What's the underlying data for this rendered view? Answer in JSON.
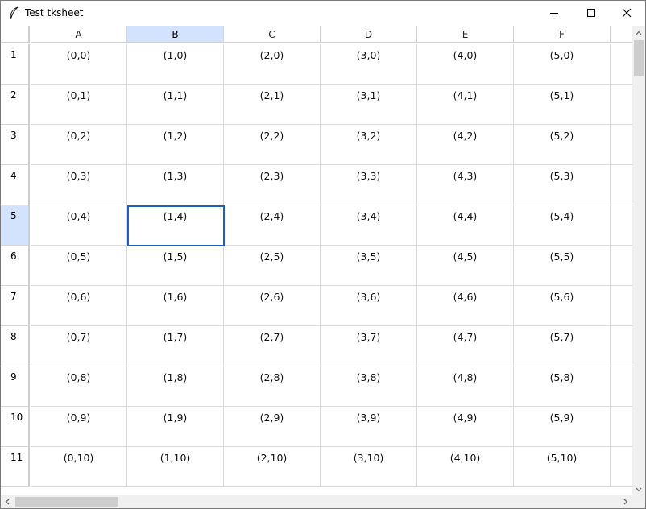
{
  "window": {
    "title": "Test tksheet"
  },
  "icons": {
    "app": "feather-icon",
    "minimize": "minimize-icon",
    "maximize": "maximize-icon",
    "close": "close-icon"
  },
  "colors": {
    "selected_header": "#d3e3fd",
    "selection_border": "#1f5fbf"
  },
  "sheet": {
    "columns": [
      "A",
      "B",
      "C",
      "D",
      "E",
      "F"
    ],
    "selected_column": "B",
    "selected_row": "5",
    "rows": [
      {
        "label": "1",
        "cells": [
          "(0,0)",
          "(1,0)",
          "(2,0)",
          "(3,0)",
          "(4,0)",
          "(5,0)"
        ]
      },
      {
        "label": "2",
        "cells": [
          "(0,1)",
          "(1,1)",
          "(2,1)",
          "(3,1)",
          "(4,1)",
          "(5,1)"
        ]
      },
      {
        "label": "3",
        "cells": [
          "(0,2)",
          "(1,2)",
          "(2,2)",
          "(3,2)",
          "(4,2)",
          "(5,2)"
        ]
      },
      {
        "label": "4",
        "cells": [
          "(0,3)",
          "(1,3)",
          "(2,3)",
          "(3,3)",
          "(4,3)",
          "(5,3)"
        ]
      },
      {
        "label": "5",
        "cells": [
          "(0,4)",
          "(1,4)",
          "(2,4)",
          "(3,4)",
          "(4,4)",
          "(5,4)"
        ]
      },
      {
        "label": "6",
        "cells": [
          "(0,5)",
          "(1,5)",
          "(2,5)",
          "(3,5)",
          "(4,5)",
          "(5,5)"
        ]
      },
      {
        "label": "7",
        "cells": [
          "(0,6)",
          "(1,6)",
          "(2,6)",
          "(3,6)",
          "(4,6)",
          "(5,6)"
        ]
      },
      {
        "label": "8",
        "cells": [
          "(0,7)",
          "(1,7)",
          "(2,7)",
          "(3,7)",
          "(4,7)",
          "(5,7)"
        ]
      },
      {
        "label": "9",
        "cells": [
          "(0,8)",
          "(1,8)",
          "(2,8)",
          "(3,8)",
          "(4,8)",
          "(5,8)"
        ]
      },
      {
        "label": "10",
        "cells": [
          "(0,9)",
          "(1,9)",
          "(2,9)",
          "(3,9)",
          "(4,9)",
          "(5,9)"
        ]
      },
      {
        "label": "11",
        "cells": [
          "(0,10)",
          "(1,10)",
          "(2,10)",
          "(3,10)",
          "(4,10)",
          "(5,10)"
        ]
      }
    ]
  }
}
